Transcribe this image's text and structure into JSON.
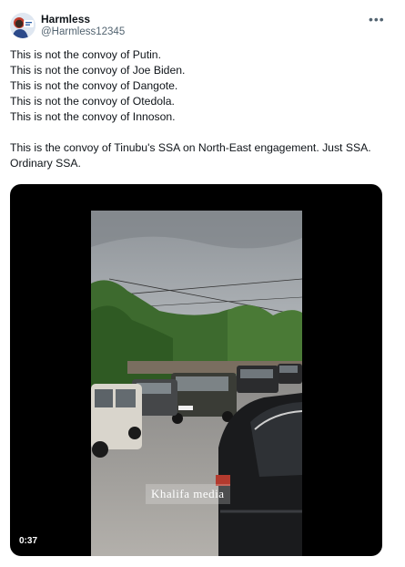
{
  "author": {
    "name": "Harmless",
    "handle": "@Harmless12345"
  },
  "tweet": {
    "lines": [
      "This is not the convoy of Putin.",
      "This is not the convoy of Joe Biden.",
      "This is not the convoy of Dangote.",
      "This is not the convoy of Otedola.",
      "This is not the convoy of Innoson.",
      "",
      "This is the convoy of Tinubu's SSA on North-East engagement. Just SSA.",
      "Ordinary SSA."
    ]
  },
  "video": {
    "duration": "0:37",
    "watermark": "Khalifa media"
  },
  "icons": {
    "more": "more-horizontal-icon"
  }
}
